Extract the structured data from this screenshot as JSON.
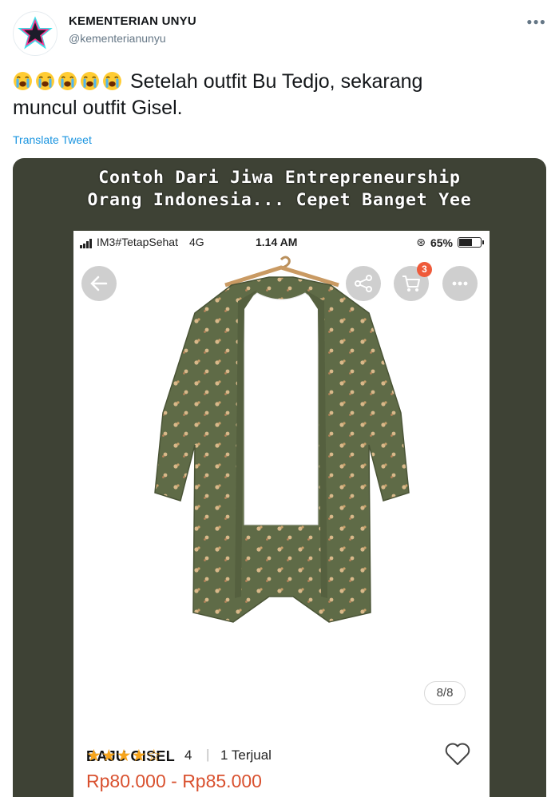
{
  "tweet": {
    "display_name": "KEMENTERIAN UNYU",
    "handle": "@kementerianunyu",
    "emoji_count": 5,
    "text_line1": "Setelah outfit Bu Tedjo, sekarang",
    "text_line2": "muncul outfit Gisel.",
    "translate_label": "Translate Tweet",
    "more_icon": "more-dots-icon"
  },
  "media": {
    "caption_line1": "Contoh Dari Jiwa Entrepreneurship",
    "caption_line2": "Orang Indonesia... Cepet Banget Yee",
    "background": "#3e4235"
  },
  "phone": {
    "carrier": "IM3#TetapSehat",
    "network": "4G",
    "time": "1.14 AM",
    "battery": "65%",
    "battery_level": 0.65,
    "cart_badge": "3",
    "image_counter": "8/8"
  },
  "product": {
    "name": "BAJU GISEL",
    "price": "Rp80.000 - Rp85.000",
    "rating": 4,
    "rating_max": 5,
    "rating_label": "4",
    "sold_label": "1 Terjual",
    "price_color": "#d9512f",
    "star_color": "#f7a51c"
  }
}
